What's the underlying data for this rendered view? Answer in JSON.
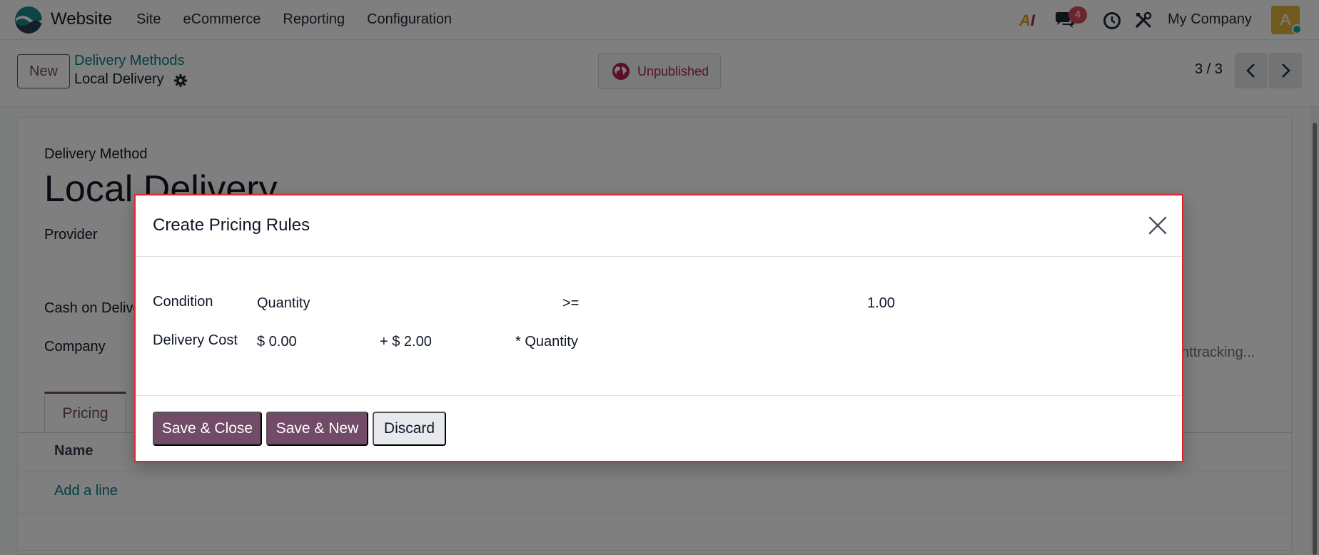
{
  "navbar": {
    "app_name": "Website",
    "menu": [
      "Site",
      "eCommerce",
      "Reporting",
      "Configuration"
    ],
    "ai_label": "AI",
    "chat_count": "4",
    "company": "My Company",
    "avatar_letter": "A"
  },
  "control_panel": {
    "new_label": "New",
    "breadcrumb_parent": "Delivery Methods",
    "breadcrumb_current": "Local Delivery",
    "status_label": "Unpublished",
    "pager": "3 / 3"
  },
  "form": {
    "header_label": "Delivery Method",
    "title": "Local Delivery",
    "provider_label": "Provider",
    "cash_label": "Cash on Delive",
    "company_label": "Company",
    "tracking_text": "nttracking...",
    "tab_pricing": "Pricing",
    "col_name": "Name",
    "add_line": "Add a line"
  },
  "modal": {
    "title": "Create Pricing Rules",
    "condition_label": "Condition",
    "condition_variable": "Quantity",
    "condition_operator": ">=",
    "condition_value": "1.00",
    "cost_label": "Delivery Cost",
    "cost_fixed": "$ 0.00",
    "cost_variable": "+ $ 2.00",
    "cost_factor": "* Quantity",
    "save_close": "Save & Close",
    "save_new": "Save & New",
    "discard": "Discard"
  },
  "colors": {
    "primary": "#714b67",
    "link": "#017e84",
    "status": "#b3234f",
    "badge": "#d44c59",
    "modal_border": "#e0242c"
  }
}
